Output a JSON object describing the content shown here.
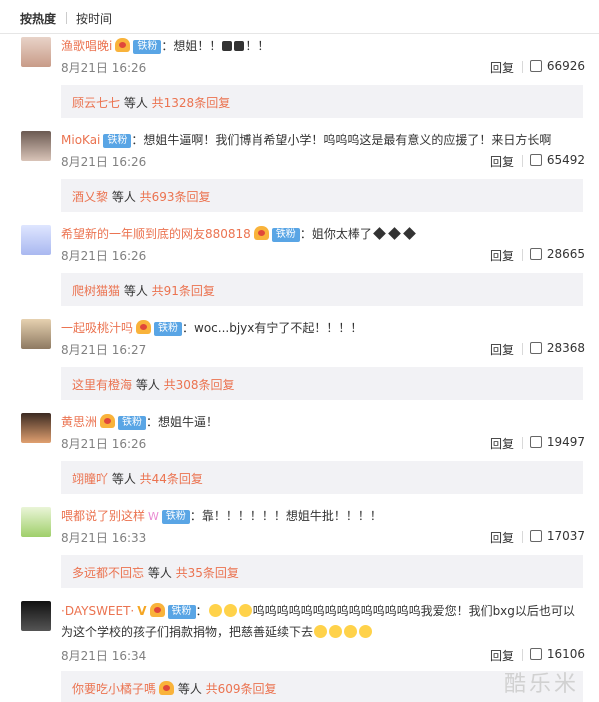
{
  "sort_tabs": {
    "hot": "按热度",
    "time": "按时间"
  },
  "reply_label": "回复",
  "comments": [
    {
      "user": "渔歌唱晚i",
      "badge": "铁粉",
      "text": "：想姐！！",
      "emo_tail": "！！",
      "time": "8月21日 16:26",
      "likes": "66926",
      "sub_user": "顾云七七",
      "sub_mid": " 等人 ",
      "sub_count": "共1328条回复"
    },
    {
      "user": "MioKai",
      "badge": "铁粉",
      "text": "：想姐牛逼啊！我们博肖希望小学！呜呜呜这是最有意义的应援了！来日方长啊",
      "time": "8月21日 16:26",
      "likes": "65492",
      "sub_user": "酒乂黎",
      "sub_mid": " 等人 ",
      "sub_count": "共693条回复"
    },
    {
      "user": "希望新的一年顺到底的网友880818",
      "badge": "铁粉",
      "text": "：姐你太棒了",
      "time": "8月21日 16:26",
      "likes": "28665",
      "sub_user": "爬树猫猫",
      "sub_mid": " 等人 ",
      "sub_count": "共91条回复"
    },
    {
      "user": "一起吸桃汁吗",
      "badge": "铁粉",
      "text": "：woc...bjyx有宁了不起！！！！",
      "time": "8月21日 16:27",
      "likes": "28368",
      "sub_user": "这里有橙海",
      "sub_mid": " 等人 ",
      "sub_count": "共308条回复"
    },
    {
      "user": "黄思洲",
      "badge": "铁粉",
      "text": "：想姐牛逼！",
      "time": "8月21日 16:26",
      "likes": "19497",
      "sub_user": "翊瞳吖",
      "sub_mid": " 等人 ",
      "sub_count": "共44条回复"
    },
    {
      "user": "喂都说了别这样",
      "badge": "铁粉",
      "text": "：靠！！！！！！想姐牛批！！！！",
      "time": "8月21日 16:33",
      "likes": "17037",
      "sub_user": "多远都不回忘",
      "sub_mid": " 等人 ",
      "sub_count": "共35条回复"
    },
    {
      "user": "·DAYSWEET·",
      "badge": "铁粉",
      "text_a": "：",
      "text_b": "呜呜呜呜呜呜呜呜呜呜呜呜呜呜我爱您！我们bxg以后也可以为这个学校的孩子们捐款捐物，把慈善延续下去",
      "time": "8月21日 16:34",
      "likes": "16106",
      "sub_user": "你要吃小橘子嗎",
      "sub_mid": " 等人 ",
      "sub_count": "共609条回复"
    }
  ],
  "watermark": "酷乐米",
  "colors": {
    "username": "#eb7350",
    "badge": "#59a5e5",
    "sub_bg": "#f2f2f5"
  },
  "icons": [
    "thumbs-up-icon",
    "vip-icon",
    "avatar"
  ]
}
